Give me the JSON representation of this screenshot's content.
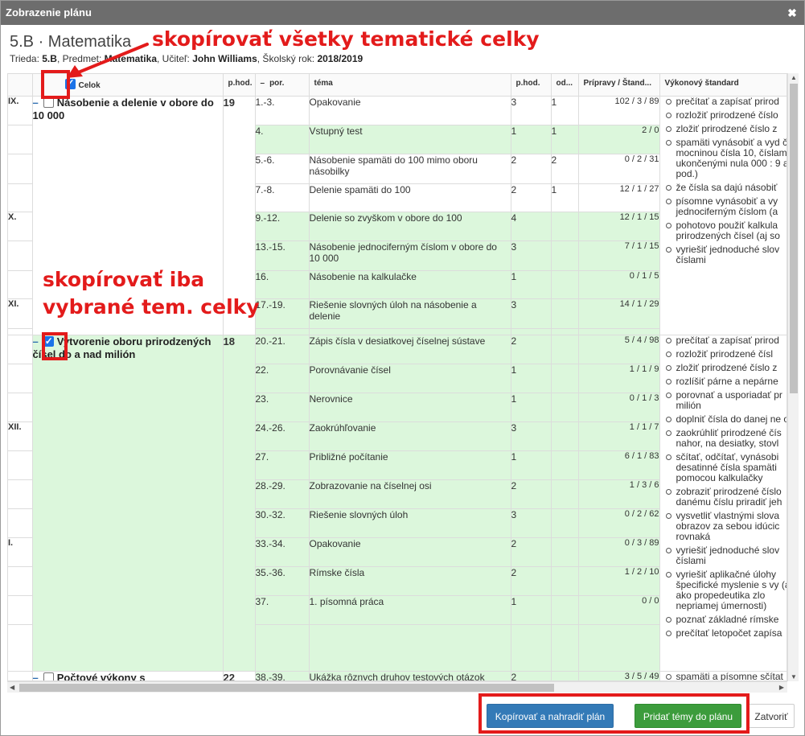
{
  "dialog": {
    "title": "Zobrazenie plánu",
    "close": "✖"
  },
  "heading": "5.B · Matematika",
  "subline": {
    "trieda_label": "Trieda: ",
    "trieda": "5.B",
    "predmet_label": ", Predmet: ",
    "predmet": "Matematika",
    "ucitel_label": ", Učiteľ: ",
    "ucitel": "John Williams",
    "rok_label": ", Školský rok: ",
    "rok": "2018/2019"
  },
  "columns": {
    "celok": "Celok",
    "phod": "p.hod.",
    "por_dash": "–",
    "por": "por.",
    "tema": "téma",
    "phod2": "p.hod.",
    "od": "od...",
    "pripravy": "Prípravy / Štand...",
    "vykon": "Výkonový štandard"
  },
  "months": [
    "IX.",
    "X.",
    "XI.",
    "XII.",
    "I."
  ],
  "units": [
    {
      "title": "Násobenie a delenie v obore do 10 000",
      "hours": "19",
      "checked": false,
      "rows": [
        {
          "por": "1.-3.",
          "tema": "Opakovanie",
          "phod": "3",
          "od": "1",
          "prip": "102 / 3 / 89"
        },
        {
          "por": "4.",
          "tema": "Vstupný test",
          "phod": "1",
          "od": "1",
          "prip": "2 / 0"
        },
        {
          "por": "5.-6.",
          "tema": "Násobenie spamäti do 100 mimo oboru násobilky",
          "phod": "2",
          "od": "2",
          "prip": "0 / 2 / 31"
        },
        {
          "por": "7.-8.",
          "tema": "Delenie spamäti do 100",
          "phod": "2",
          "od": "1",
          "prip": "12 / 1 / 27"
        },
        {
          "por": "9.-12.",
          "tema": "Delenie so zvyškom v obore do 100",
          "phod": "4",
          "od": "",
          "prip": "12 / 1 / 15"
        },
        {
          "por": "13.-15.",
          "tema": "Násobenie jednociferným číslom v obore do 10 000",
          "phod": "3",
          "od": "",
          "prip": "7 / 1 / 15"
        },
        {
          "por": "16.",
          "tema": "Násobenie na kalkulačke",
          "phod": "1",
          "od": "",
          "prip": "0 / 1 / 5"
        },
        {
          "por": "17.-19.",
          "tema": "Riešenie slovných úloh na násobenie a delenie",
          "phod": "3",
          "od": "",
          "prip": "14 / 1 / 29"
        }
      ],
      "standards": [
        "prečítať a zapísať prirod",
        "rozložiť prirodzené číslo",
        "zložiť prirodzené číslo z",
        "spamäti vynásobiť a vyd čísla mocninou čísla 10, číslami ukončenými nula 000 : 9 a pod.)",
        "že čísla sa dajú násobiť",
        "písomne vynásobiť a vy jednociferným číslom (a",
        "pohotovo použiť kalkula prirodzených čísel (aj so",
        "vyriešiť jednoduché slov číslami"
      ]
    },
    {
      "title": "Vytvorenie oboru prirodzených čísel do a nad milión",
      "hours": "18",
      "checked": true,
      "rows": [
        {
          "por": "20.-21.",
          "tema": "Zápis čísla v desiatkovej číselnej sústave",
          "phod": "2",
          "od": "",
          "prip": "5 / 4 / 98"
        },
        {
          "por": "22.",
          "tema": "Porovnávanie čísel",
          "phod": "1",
          "od": "",
          "prip": "1 / 1 / 9"
        },
        {
          "por": "23.",
          "tema": "Nerovnice",
          "phod": "1",
          "od": "",
          "prip": "0 / 1 / 3"
        },
        {
          "por": "24.-26.",
          "tema": "Zaokrúhľovanie",
          "phod": "3",
          "od": "",
          "prip": "1 / 1 / 7"
        },
        {
          "por": "27.",
          "tema": "Približné počítanie",
          "phod": "1",
          "od": "",
          "prip": "6 / 1 / 83"
        },
        {
          "por": "28.-29.",
          "tema": "Zobrazovanie na číselnej osi",
          "phod": "2",
          "od": "",
          "prip": "1 / 3 / 6"
        },
        {
          "por": "30.-32.",
          "tema": "Riešenie slovných úloh",
          "phod": "3",
          "od": "",
          "prip": "0 / 2 / 62"
        },
        {
          "por": "33.-34.",
          "tema": "Opakovanie",
          "phod": "2",
          "od": "",
          "prip": "0 / 3 / 89"
        },
        {
          "por": "35.-36.",
          "tema": "Rímske čísla",
          "phod": "2",
          "od": "",
          "prip": "1 / 2 / 10"
        },
        {
          "por": "37.",
          "tema": "1. písomná práca",
          "phod": "1",
          "od": "",
          "prip": "0 / 0"
        }
      ],
      "standards": [
        "prečítať a zapísať prirod",
        "rozložiť prirodzené čísl",
        "zložiť prirodzené číslo z",
        "rozlíšiť párne a nepárne",
        "porovnať a usporiadať pr milión",
        "doplniť čísla do danej ne osi",
        "zaokrúhliť prirodzené čís nahor, na desiatky, stovl",
        "sčítať, odčítať, vynásobi desatinné čísla spamäti pomocou kalkulačky",
        "zobraziť prirodzené číslo danému číslu priradiť jeh",
        "vysvetliť vlastnými slova obrazov za sebou idúcic rovnaká",
        "vyriešiť jednoduché slov číslami",
        "vyriešiť aplikačné úlohy špecifické myslenie s vy (aj ako propedeutika zlo nepriamej úmernosti)",
        "poznať základné rímske",
        "prečítať letopočet zapísa"
      ]
    },
    {
      "title": "Počtové výkony s",
      "hours": "22",
      "checked": false,
      "rows": [
        {
          "por": "38.-39.",
          "tema": "Ukážka rôznych druhov testových otázok",
          "phod": "2",
          "od": "",
          "prip": "3 / 5 / 49"
        }
      ],
      "standards": [
        "spamäti a písomne sčítat"
      ]
    }
  ],
  "buttons": {
    "copy_replace": "Kopírovať a nahradiť plán",
    "add": "Pridať témy do plánu",
    "close": "Zatvoriť"
  },
  "annotations": {
    "copy_all": "skopírovať všetky tematické celky",
    "copy_selected_1": "skopírovať iba",
    "copy_selected_2": "vybrané tem. celky"
  },
  "colors": {
    "accent_red": "#e31b1b",
    "row_green": "#dcf7dc",
    "btn_blue": "#337ab7",
    "btn_green": "#3c9c3c",
    "titlebar": "#6d6d6d"
  }
}
